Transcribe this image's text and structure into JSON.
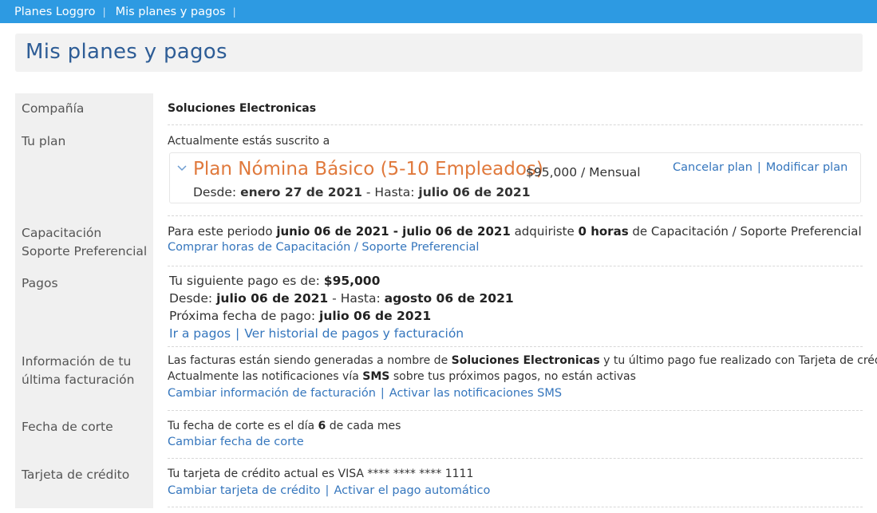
{
  "topbar": {
    "crumb_home": "Planes Loggro",
    "crumb_current": "Mis planes y pagos"
  },
  "page_title": "Mis planes y pagos",
  "labels": {
    "company": "Compañía",
    "plan": "Tu plan",
    "training_1": "Capacitación",
    "training_2": "Soporte Preferencial",
    "payments": "Pagos",
    "billing_1": "Información de tu",
    "billing_2": "última facturación",
    "cutoff": "Fecha de corte",
    "card": "Tarjeta de crédito"
  },
  "company": {
    "name": "Soluciones Electronicas"
  },
  "plan": {
    "subscribed_text": "Actualmente estás suscrito a",
    "name": "Plan Nómina Básico (5-10 Empleados)",
    "price": "$95,000 / Mensual",
    "cancel_label": "Cancelar plan",
    "modify_label": "Modificar plan",
    "from_label": "Desde:",
    "from_date": "enero 27 de 2021",
    "to_label": "- Hasta:",
    "to_date": "julio 06 de 2021"
  },
  "training": {
    "prefix": "Para este periodo",
    "period": "junio 06 de 2021 - julio 06 de 2021",
    "middle": "adquiriste",
    "hours": "0 horas",
    "suffix": "de Capacitación / Soporte Preferencial",
    "buy_label": "Comprar horas de Capacitación / Soporte Preferencial"
  },
  "payments": {
    "next_label": "Tu siguiente pago es de:",
    "next_amount": "$95,000",
    "from_label": "Desde:",
    "from_date": "julio 06 de 2021",
    "to_label": "- Hasta:",
    "to_date": "agosto 06 de 2021",
    "next_date_label": "Próxima fecha de pago:",
    "next_date": "julio 06 de 2021",
    "go_label": "Ir a pagos",
    "history_label": "Ver historial de pagos y facturación"
  },
  "billing": {
    "line1_prefix": "Las facturas están siendo generadas a nombre de",
    "line1_company": "Soluciones Electronicas",
    "line1_suffix": "y tu último pago fue realizado con Tarjeta de crédito",
    "line2_prefix": "Actualmente las notificaciones vía",
    "line2_sms": "SMS",
    "line2_suffix": "sobre tus próximos pagos, no están activas",
    "change_label": "Cambiar información de facturación",
    "sms_label": "Activar las notificaciones SMS"
  },
  "cutoff": {
    "prefix": "Tu fecha de corte es el día",
    "day": "6",
    "suffix": "de cada mes",
    "change_label": "Cambiar fecha de corte"
  },
  "card": {
    "text": "Tu tarjeta de crédito actual es VISA **** **** **** 1111",
    "change_label": "Cambiar tarjeta de crédito",
    "autopay_label": "Activar el pago automático"
  },
  "colors": {
    "topbar": "#2d9ae2",
    "title": "#2e5d96",
    "plan_name": "#e0793c",
    "link": "#3576bd"
  }
}
